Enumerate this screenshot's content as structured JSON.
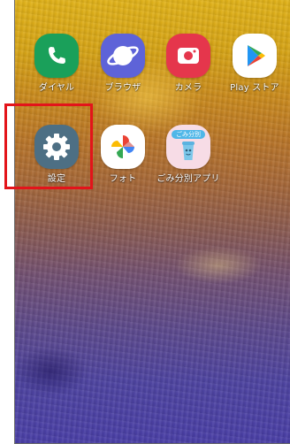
{
  "apps": [
    {
      "name": "dialer",
      "label": "ダイヤル",
      "icon": "phone-icon",
      "color": "#1aa05a"
    },
    {
      "name": "browser",
      "label": "ブラウザ",
      "icon": "planet-icon",
      "color": "#5e63d8"
    },
    {
      "name": "camera",
      "label": "カメラ",
      "icon": "camera-icon",
      "color": "#e5364c"
    },
    {
      "name": "play-store",
      "label": "Play ストア",
      "icon": "play-store-icon",
      "color": "#ffffff"
    },
    {
      "name": "settings",
      "label": "設定",
      "icon": "gear-icon",
      "color": "#4d6f84"
    },
    {
      "name": "photos",
      "label": "フォト",
      "icon": "pinwheel-icon",
      "color": "#ffffff"
    },
    {
      "name": "garbage-app",
      "label": "ごみ分別アプリ",
      "icon": "garbage-app-icon",
      "color": "#f7dce6"
    }
  ],
  "garbage_icon_text": "ごみ分別",
  "highlight": {
    "target": "settings",
    "color": "#e3141a"
  }
}
